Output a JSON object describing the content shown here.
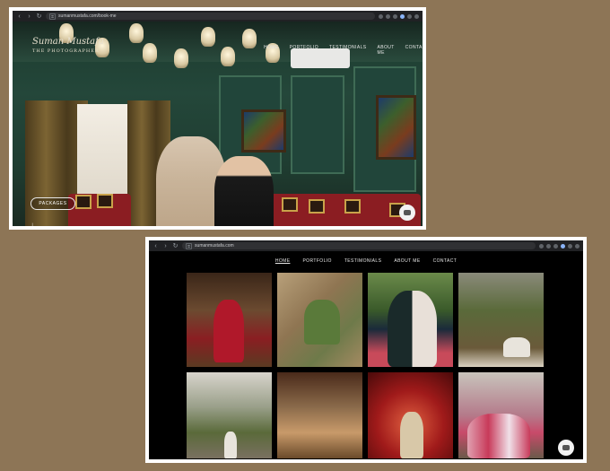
{
  "screenshot_top": {
    "url": "sumanmustafa.com/book-me",
    "logo": {
      "script": "Suman Mustafa",
      "sub": "THE PHOTOGRAPHER"
    },
    "menu": [
      "HOME",
      "PORTFOLIO",
      "TESTIMONIALS",
      "ABOUT ME",
      "CONTACT"
    ],
    "packages_label": "PACKAGES",
    "icons": [
      "back-arrow-icon",
      "forward-arrow-icon",
      "refresh-icon",
      "down-arrow-icon",
      "chat-icon"
    ]
  },
  "screenshot_bottom": {
    "url": "sumanmustafa.com",
    "menu": [
      "HOME",
      "PORTFOLIO",
      "TESTIMONIALS",
      "ABOUT ME",
      "CONTACT"
    ],
    "active_menu": "HOME",
    "photos": [
      "bride-in-red-doorway",
      "couple-on-floor",
      "couple-embrace",
      "woman-under-tree",
      "bride-by-wall",
      "wooden-arch-hall",
      "bride-red-backdrop",
      "family-group"
    ]
  },
  "colors": {
    "page_background": "#8d7556",
    "browser_bar": "#202124",
    "site_background": "#000000",
    "hero_green": "#24473a"
  }
}
